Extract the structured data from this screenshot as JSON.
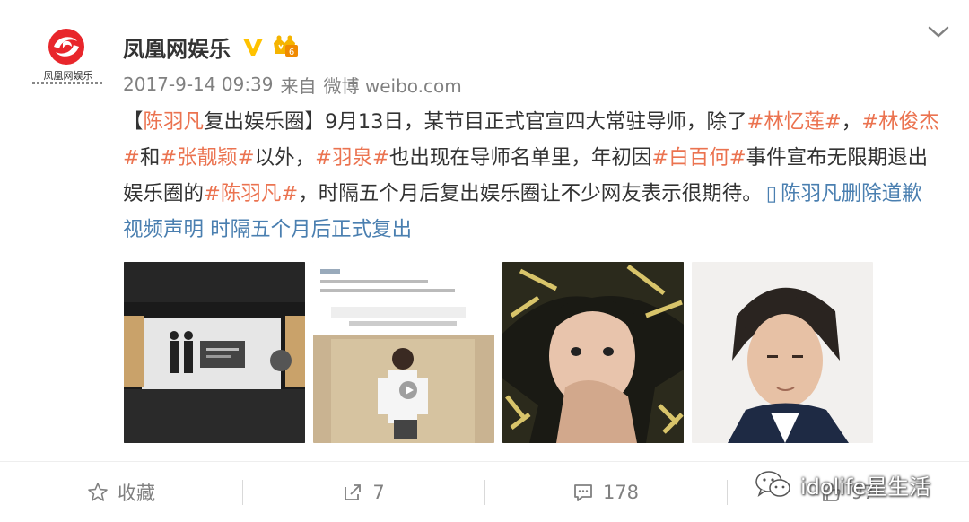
{
  "post": {
    "account_name": "凤凰网娱乐",
    "avatar_caption": "凤凰网娱乐",
    "timestamp": "2017-9-14 09:39",
    "source_prefix": "来自",
    "source": "微博 weibo.com",
    "text": {
      "seg1": "【",
      "seg2": "陈羽凡",
      "seg3": "复出娱乐圈】9月13日，某节目正式官宣四大常驻导师，除了",
      "seg4": "#林忆莲#",
      "seg5": "，",
      "seg6": "#林俊杰#",
      "seg7": "和",
      "seg8": "#张靓颖#",
      "seg9": "以外，",
      "seg10": "#羽泉#",
      "seg11": "也出现在导师名单里，年初因",
      "seg12": "#白百何#",
      "seg13": "事件宣布无限期退出娱乐圈的",
      "seg14": "#陈羽凡#",
      "seg15": "，时隔五个月后复出娱乐圈让不少网友表示很期待。",
      "link": "陈羽凡删除道歉视频声明 时隔五个月后正式复出"
    },
    "images": [
      {
        "icon": "stage-event-photo"
      },
      {
        "icon": "video-screenshot-photo"
      },
      {
        "icon": "selfie-photo"
      },
      {
        "icon": "portrait-photo"
      }
    ]
  },
  "actions": {
    "favorite_label": "收藏",
    "repost_count": "7",
    "comment_count": "178",
    "like_count": "97"
  },
  "watermark": {
    "text": "idolife星生活"
  },
  "colors": {
    "tag": "#eb7350",
    "link": "#4a7fb0",
    "verified": "#ffc200",
    "logo": "#e8262b"
  }
}
